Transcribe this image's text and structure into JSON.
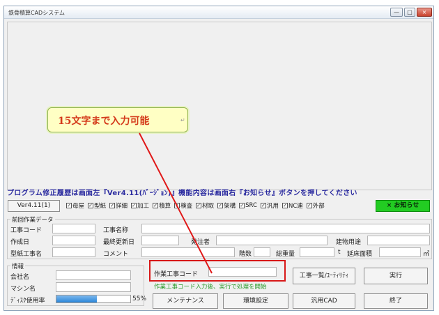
{
  "window": {
    "title": "鉄骨積算CADシステム",
    "min": "—",
    "max": "□",
    "close": "×"
  },
  "callout": {
    "text": "15文字まで入力可能",
    "mark": "↵"
  },
  "notice": "プログラム修正履歴は画面左『Ver4.11(ﾊﾞｰｼﾞｮﾝ)』機能内容は画面右『お知らせ』ボタンを押してください",
  "version_button": "Ver4.11(1)",
  "modules": [
    {
      "label": "母屋",
      "checked": true
    },
    {
      "label": "型紙",
      "checked": true
    },
    {
      "label": "詳細",
      "checked": true
    },
    {
      "label": "加工",
      "checked": true
    },
    {
      "label": "積算",
      "checked": true
    },
    {
      "label": "検査",
      "checked": true
    },
    {
      "label": "材取",
      "checked": true
    },
    {
      "label": "架構",
      "checked": true
    },
    {
      "label": "SRC",
      "checked": true
    },
    {
      "label": "汎用",
      "checked": true
    },
    {
      "label": "NC連",
      "checked": true
    },
    {
      "label": "外部",
      "checked": true
    }
  ],
  "oshirase_button": "× お知らせ",
  "previous": {
    "title": "前回作業データ",
    "code_label": "工事コード",
    "name_label": "工事名称",
    "created_label": "作成日",
    "updated_label": "最終更新日",
    "client_label": "発注者",
    "use_label": "建物用途",
    "pattern_label": "型紙工事名",
    "comment_label": "コメント",
    "floors_label": "階数",
    "weight_label": "総重量",
    "unit_t": "t",
    "area_label": "延床面積",
    "unit_m2": "㎡"
  },
  "info": {
    "title": "情報",
    "company_label": "会社名",
    "machine_label": "マシン名",
    "disk_label": "ﾃﾞｨｽｸ使用率",
    "disk_value": "55%",
    "disk_fraction": 0.55
  },
  "work_code": {
    "label": "作業工事コード",
    "value": "",
    "hint": "作業工事コード入力後、実行で処理を開始"
  },
  "buttons": {
    "list": "工事一覧/ﾕｰﾃｨﾘﾃｨ",
    "execute": "実行",
    "maintenance": "メンテナンス",
    "environment": "環境設定",
    "general_cad": "汎用CAD",
    "exit": "終了"
  },
  "colors": {
    "notice": "#2b2ba0",
    "highlight": "#d81818",
    "oshirase": "#22cc22",
    "hint": "#2a9a2a",
    "callout_text": "#d43a1a"
  }
}
